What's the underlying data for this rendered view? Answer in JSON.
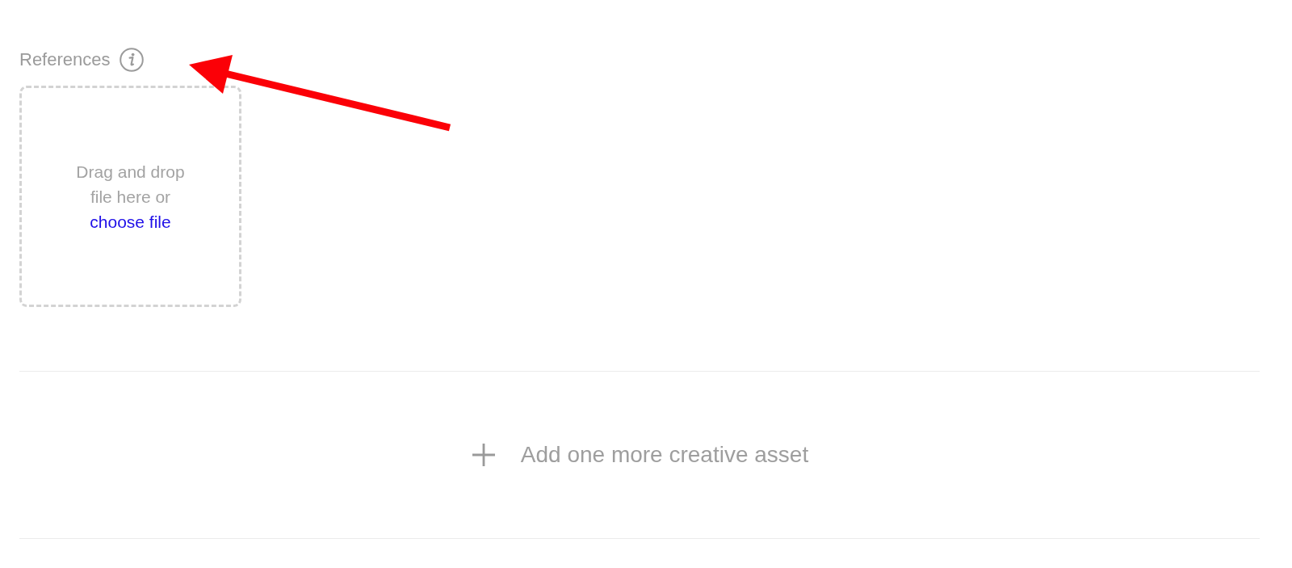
{
  "references": {
    "label": "References",
    "dropzone": {
      "text": "Drag and drop file here or",
      "link": "choose file"
    }
  },
  "add_asset": {
    "label": "Add one more creative asset"
  }
}
